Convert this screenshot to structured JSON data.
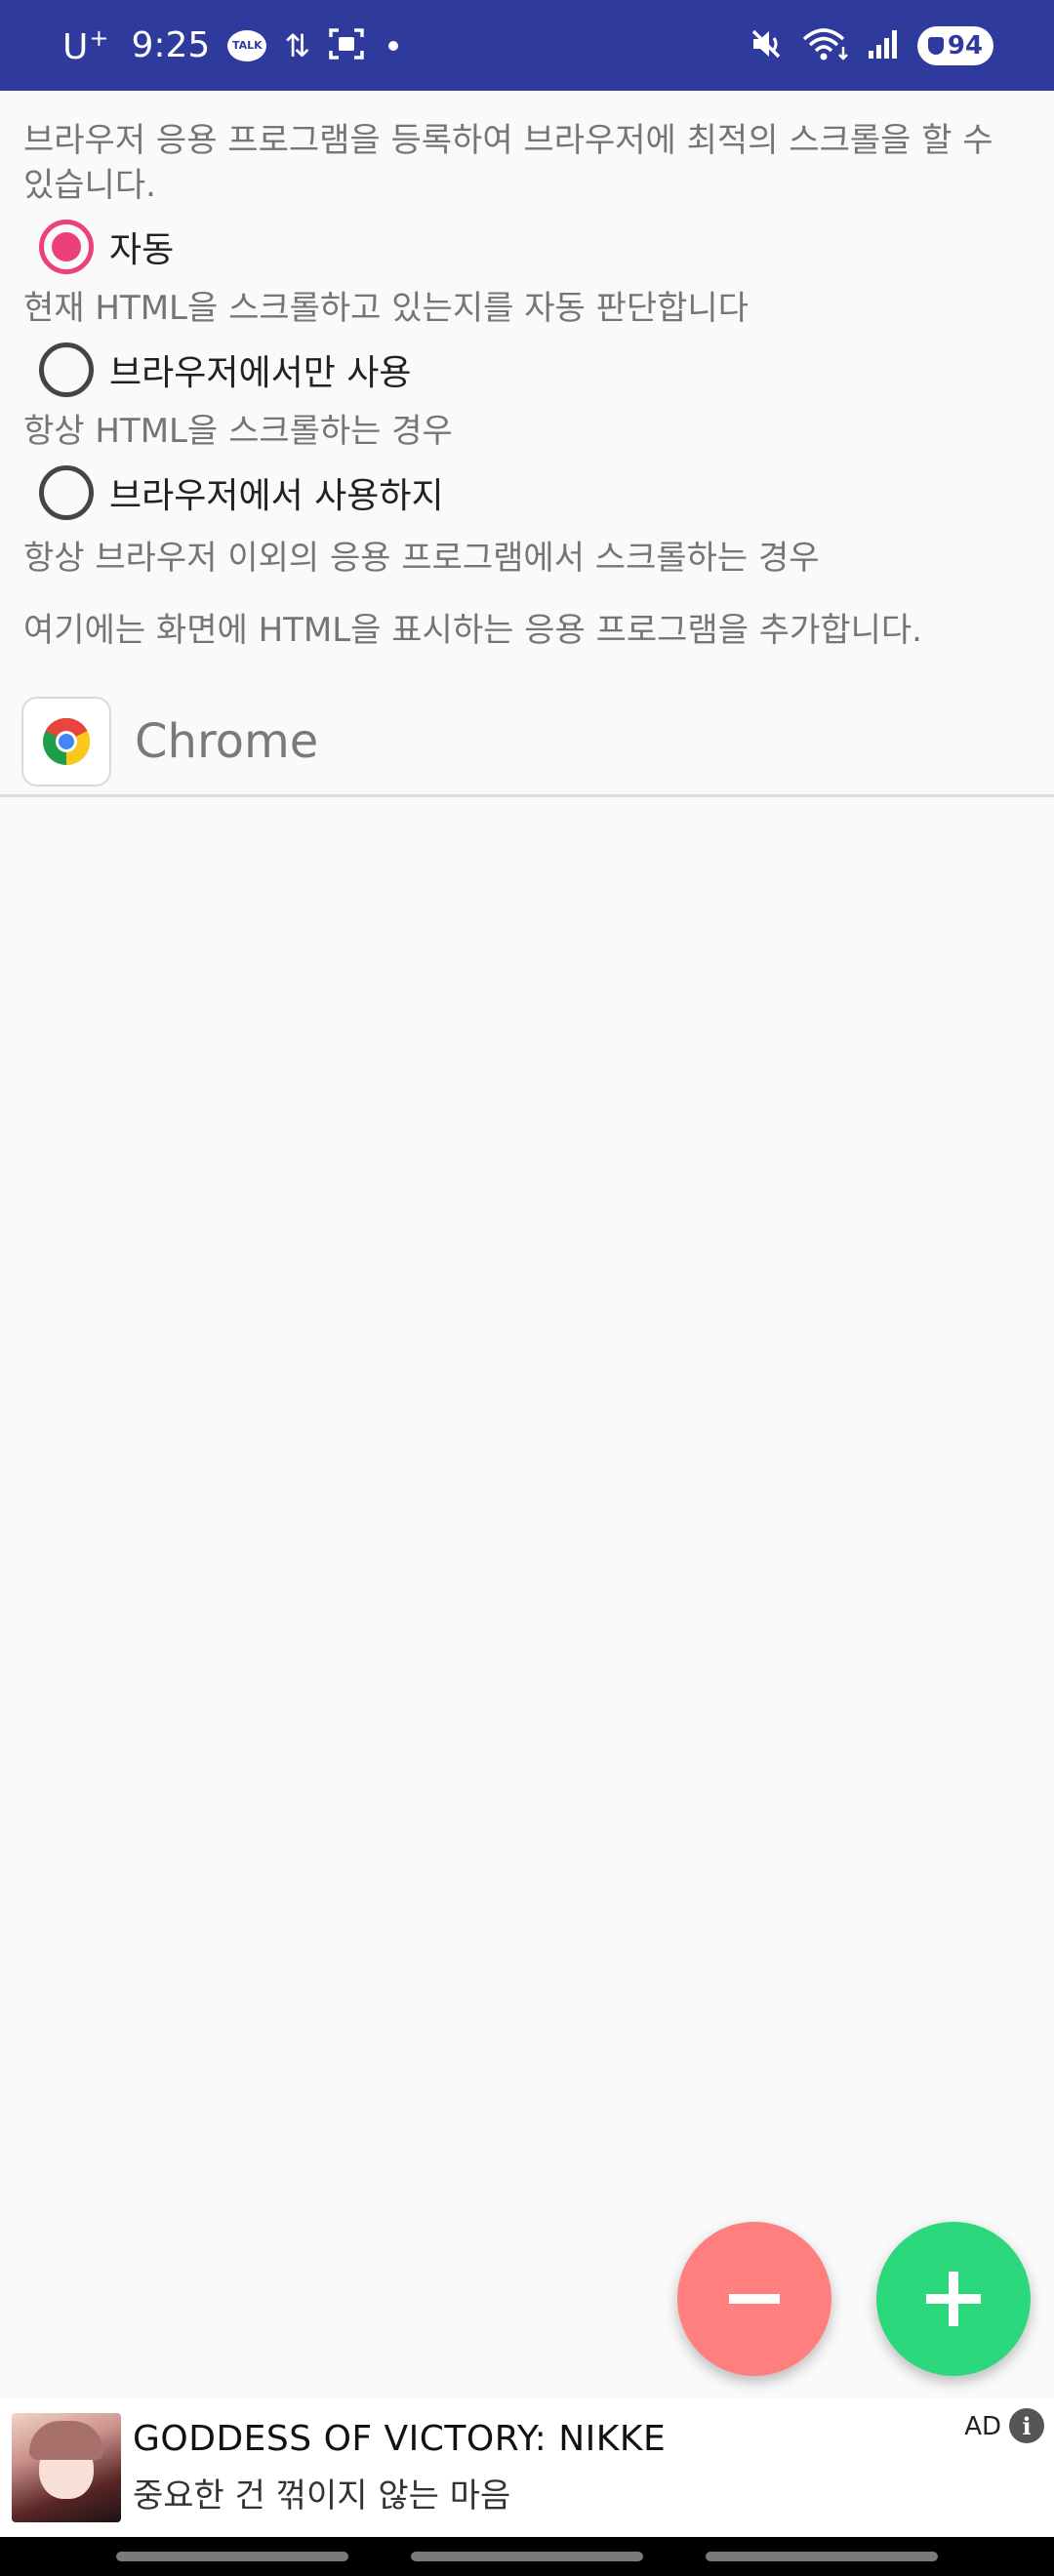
{
  "status_bar": {
    "carrier": "U",
    "carrier_sup": "+",
    "time": "9:25",
    "talk_label": "TALK",
    "battery": "94"
  },
  "main": {
    "intro": "브라우저 응용 프로그램을 등록하여 브라우저에 최적의 스크롤을 할 수 있습니다.",
    "options": [
      {
        "label": "자동",
        "description": "현재 HTML을 스크롤하고 있는지를 자동 판단합니다",
        "checked": true
      },
      {
        "label": "브라우저에서만 사용",
        "description": "항상 HTML을 스크롤하는 경우",
        "checked": false
      },
      {
        "label": "브라우저에서 사용하지",
        "description": "항상 브라우저 이외의 응용 프로그램에서 스크롤하는 경우",
        "checked": false
      }
    ],
    "add_note": "여기에는 화면에 HTML을 표시하는 응용 프로그램을 추가합니다.",
    "apps": [
      {
        "name": "Chrome",
        "icon": "chrome-icon"
      }
    ]
  },
  "fabs": {
    "remove_icon": "minus-icon",
    "add_icon": "plus-icon"
  },
  "ad": {
    "title": "GODDESS OF VICTORY: NIKKE",
    "subtitle": "중요한 건 꺾이지 않는 마음",
    "label": "AD",
    "info_glyph": "i"
  },
  "colors": {
    "status_bar": "#2e3a9c",
    "radio_accent": "#ec407a",
    "fab_remove": "#ff7f7f",
    "fab_add": "#2bd87b"
  }
}
